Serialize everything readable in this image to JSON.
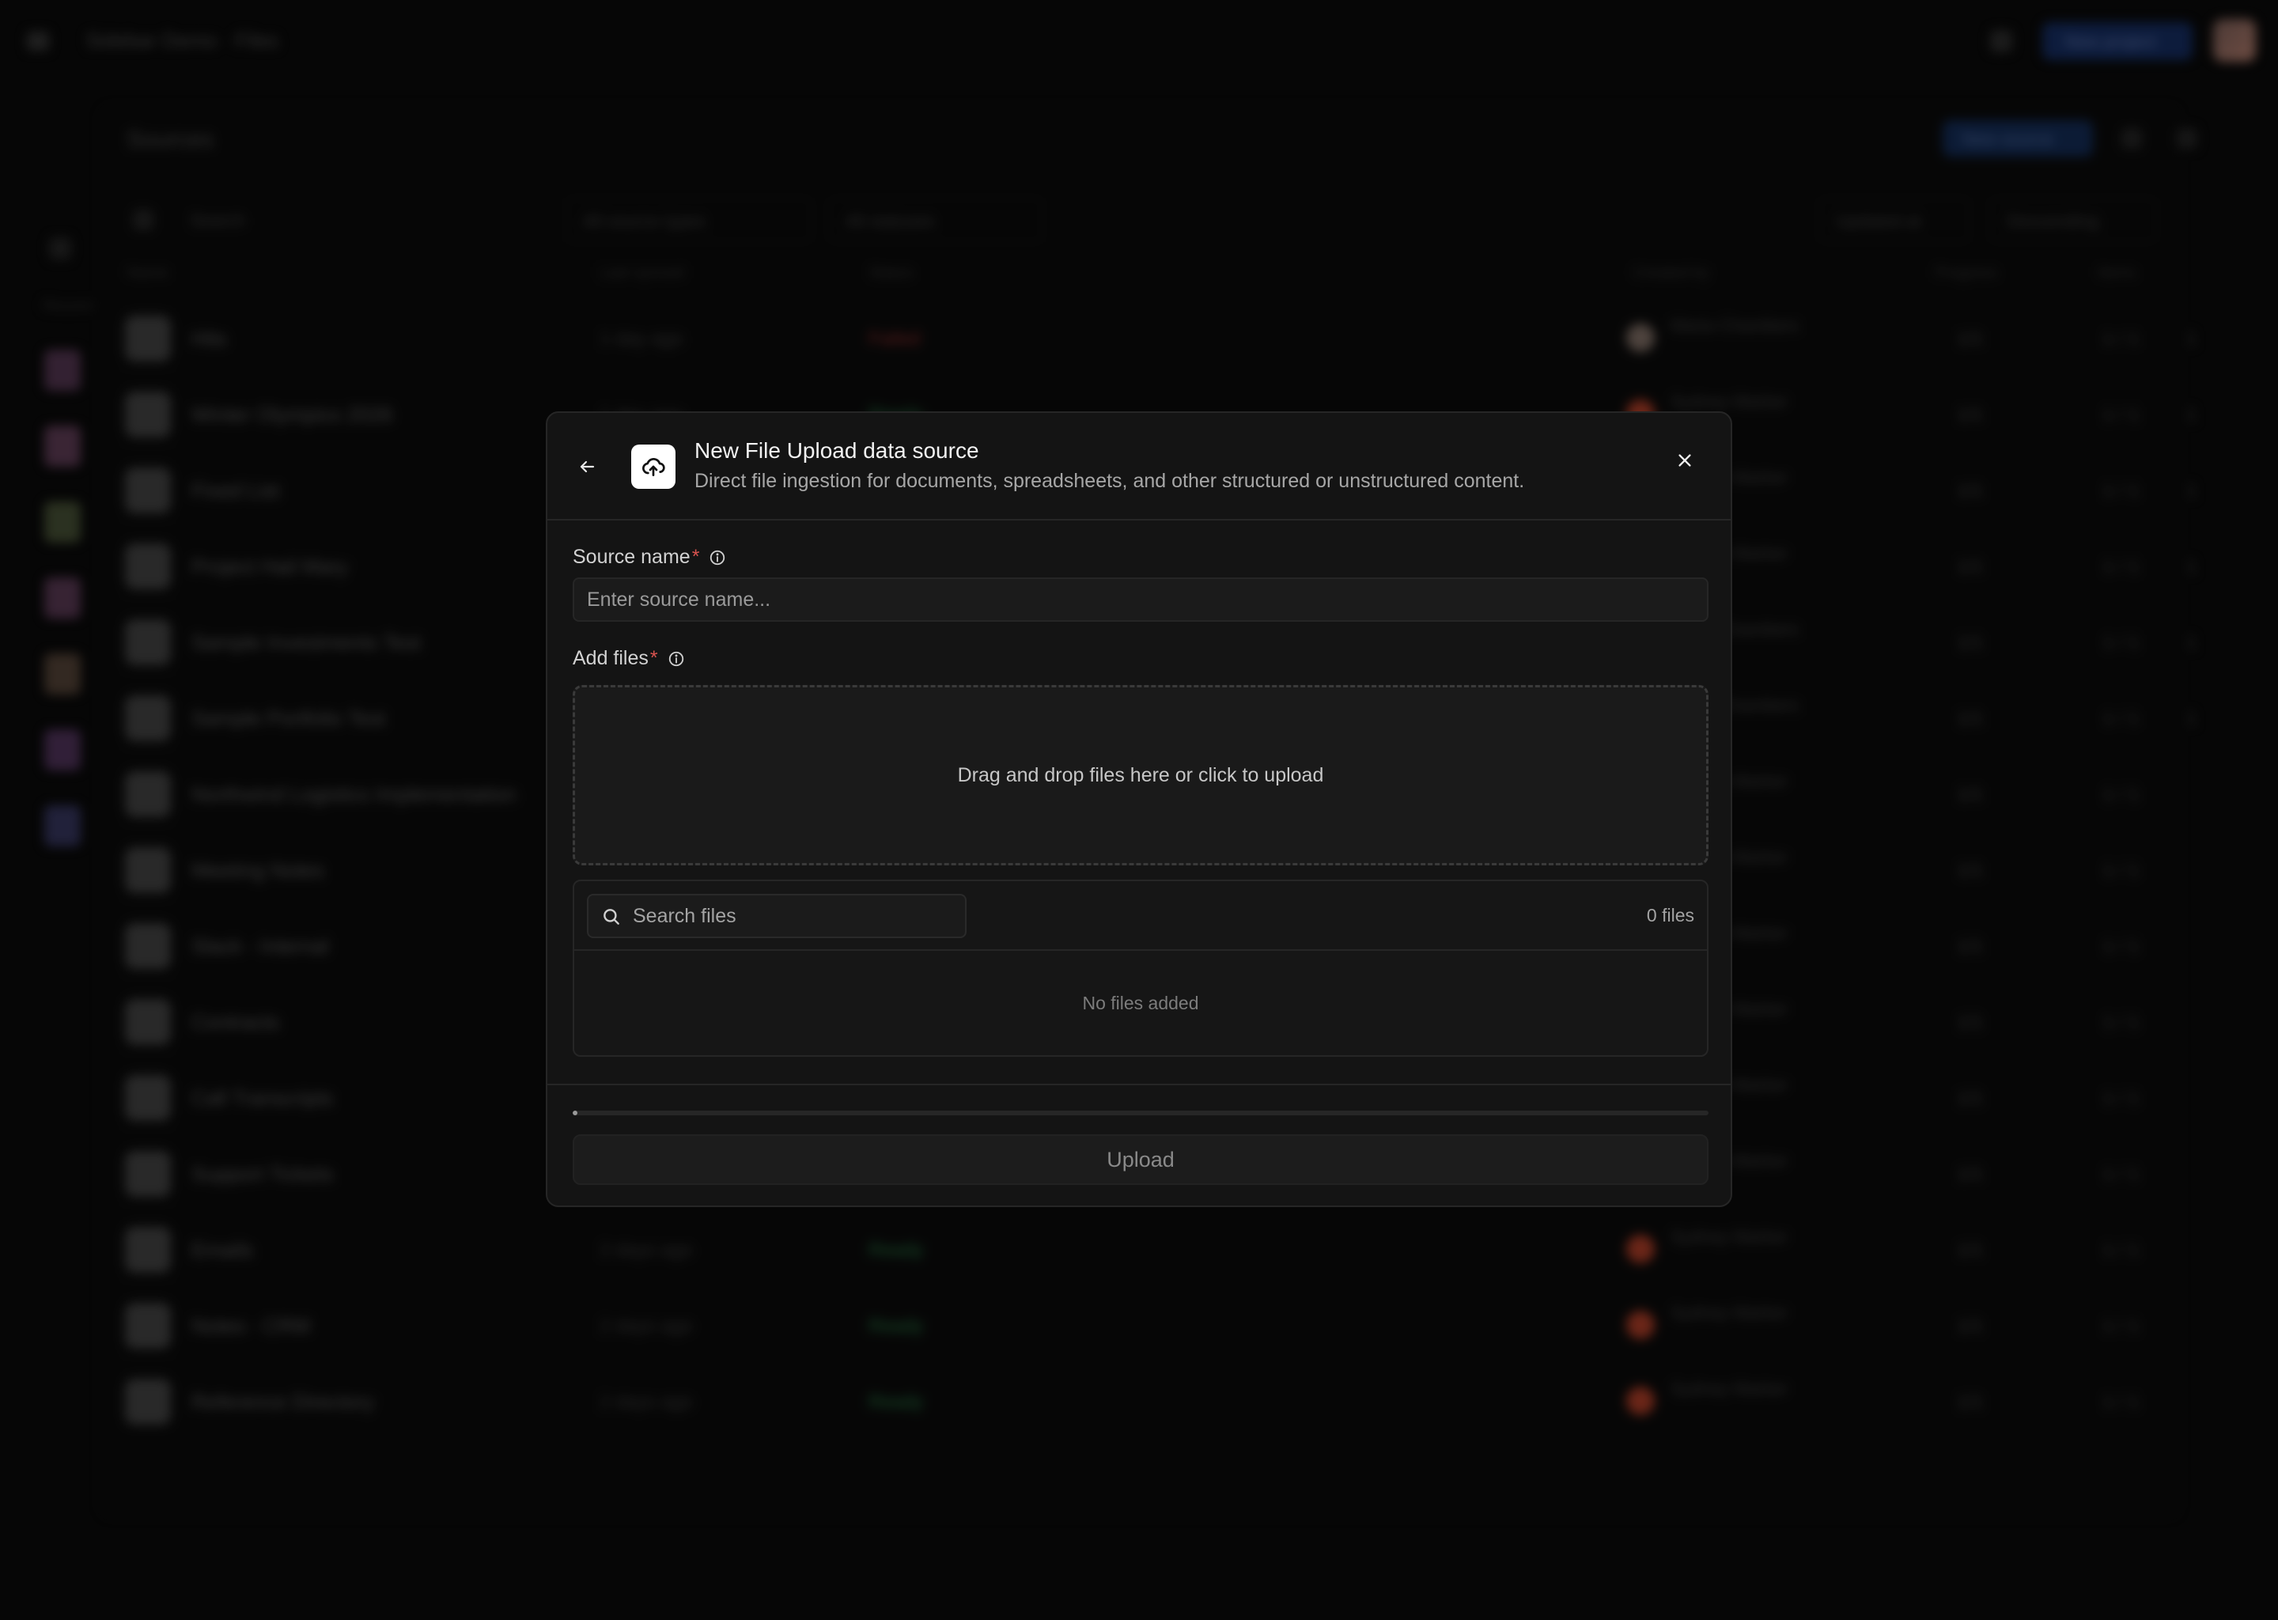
{
  "background": {
    "breadcrumb": "Sidebar Demo · Files",
    "new_button": "New project",
    "panel_title": "Sources",
    "add_source_button": "New source",
    "rail_label": "Recent",
    "search_placeholder": "Search",
    "filters": [
      "All source types",
      "All statuses",
      "Updated at",
      "Descending"
    ],
    "columns": [
      "Name",
      "Last synced",
      "Status",
      "Created by",
      "Progress",
      "Items"
    ],
    "rows": [
      {
        "name": "Hits",
        "time": "1 day ago",
        "status": "Failed",
        "who": "Maria Chambers",
        "c1": "1/1",
        "c2": "1 / 1",
        "c3": "1"
      },
      {
        "name": "Winter Olympics 2026",
        "time": "1 day ago",
        "status": "Ready",
        "who": "Sydney Marker",
        "c1": "1/1",
        "c2": "1 / 1",
        "c3": "1"
      },
      {
        "name": "Fixed List",
        "time": "1 day ago",
        "status": "Ready",
        "who": "Sydney Marker",
        "c1": "1/1",
        "c2": "1 / 1",
        "c3": "1"
      },
      {
        "name": "Project Hail Mary",
        "time": "2 days ago",
        "status": "Ready",
        "who": "Sydney Marker",
        "c1": "1/1",
        "c2": "1 / 1",
        "c3": "1"
      },
      {
        "name": "Sample Investments Test",
        "time": "2 days ago",
        "status": "Ready",
        "who": "Maria Chambers",
        "c1": "1/1",
        "c2": "1 / 1",
        "c3": "1"
      },
      {
        "name": "Sample Portfolio Test",
        "time": "2 days ago",
        "status": "Ready",
        "who": "Maria Chambers",
        "c1": "1/1",
        "c2": "1 / 1",
        "c3": "1"
      },
      {
        "name": "Northwind Logistics Implementation",
        "time": "2 days ago",
        "status": "Ready",
        "who": "Sydney Marker",
        "c1": "1/1",
        "c2": "1 / 1",
        "c3": ""
      },
      {
        "name": "Meeting Notes",
        "time": "2 days ago",
        "status": "Ready",
        "who": "Sydney Marker",
        "c1": "1/1",
        "c2": "1 / 1",
        "c3": ""
      },
      {
        "name": "Slack - Internal",
        "time": "2 days ago",
        "status": "Ready",
        "who": "Sydney Marker",
        "c1": "1/1",
        "c2": "1 / 1",
        "c3": ""
      },
      {
        "name": "Contracts",
        "time": "2 days ago",
        "status": "Ready",
        "who": "Sydney Marker",
        "c1": "1/1",
        "c2": "1 / 1",
        "c3": ""
      },
      {
        "name": "Call Transcripts",
        "time": "2 days ago",
        "status": "Ready",
        "who": "Sydney Marker",
        "c1": "1/1",
        "c2": "1 / 1",
        "c3": ""
      },
      {
        "name": "Support Tickets",
        "time": "2 days ago",
        "status": "Ready",
        "who": "Sydney Marker",
        "c1": "1/1",
        "c2": "1 / 1",
        "c3": ""
      },
      {
        "name": "Emails",
        "time": "2 days ago",
        "status": "Ready",
        "who": "Sydney Marker",
        "c1": "1/1",
        "c2": "1 / 1",
        "c3": ""
      },
      {
        "name": "Notes - CRM",
        "time": "2 days ago",
        "status": "Ready",
        "who": "Sydney Marker",
        "c1": "1/1",
        "c2": "1 / 1",
        "c3": ""
      },
      {
        "name": "Reference Directory",
        "time": "2 days ago",
        "status": "Ready",
        "who": "Sydney Marker",
        "c1": "1/1",
        "c2": "1 / 1",
        "c3": ""
      }
    ]
  },
  "modal": {
    "title": "New File Upload data source",
    "subtitle": "Direct file ingestion for documents, spreadsheets, and other structured or unstructured content.",
    "source_name_label": "Source name",
    "source_name_placeholder": "Enter source name...",
    "source_name_value": "",
    "add_files_label": "Add files",
    "required_marker": "*",
    "dropzone_text": "Drag and drop files here or click to upload",
    "search_placeholder": "Search files",
    "file_count": "0 files",
    "empty_text": "No files added",
    "progress": 0,
    "upload_label": "Upload"
  },
  "colors": {
    "accent_required": "#d9534f",
    "status_ready": "#2e8a4e",
    "status_failed": "#a33232",
    "modal_bg": "#141414"
  },
  "icons": {
    "back": "arrow-left-icon",
    "badge": "cloud-upload-icon",
    "close": "close-icon",
    "info": "info-icon",
    "search": "search-icon"
  }
}
